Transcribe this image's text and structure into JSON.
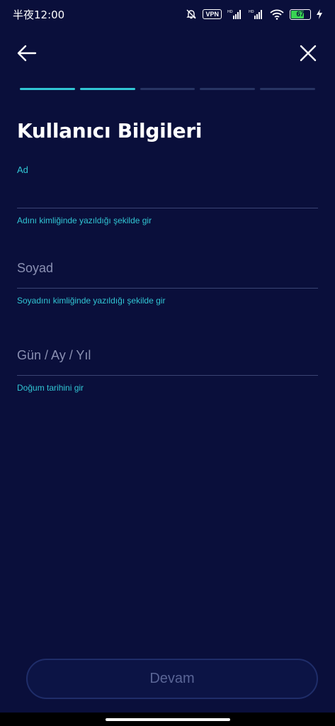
{
  "status_bar": {
    "time": "半夜12:00",
    "vpn": "VPN",
    "battery_level": 67,
    "battery_text": "67"
  },
  "progress": {
    "total_steps": 5,
    "completed_steps": 2,
    "color_done": "#31c6d4",
    "color_pending": "#283463"
  },
  "title": "Kullanıcı Bilgileri",
  "fields": {
    "first_name": {
      "label": "Ad",
      "value": "",
      "placeholder": "",
      "hint": "Adını kimliğinde yazıldığı şekilde gir"
    },
    "last_name": {
      "placeholder": "Soyad",
      "value": "",
      "hint": "Soyadını kimliğinde yazıldığı şekilde gir"
    },
    "birth_date": {
      "placeholder": "Gün / Ay / Yıl",
      "value": "",
      "hint": "Doğum tarihini gir"
    }
  },
  "continue_label": "Devam",
  "colors": {
    "background": "#0a0f3b",
    "accent": "#31c6d4"
  }
}
